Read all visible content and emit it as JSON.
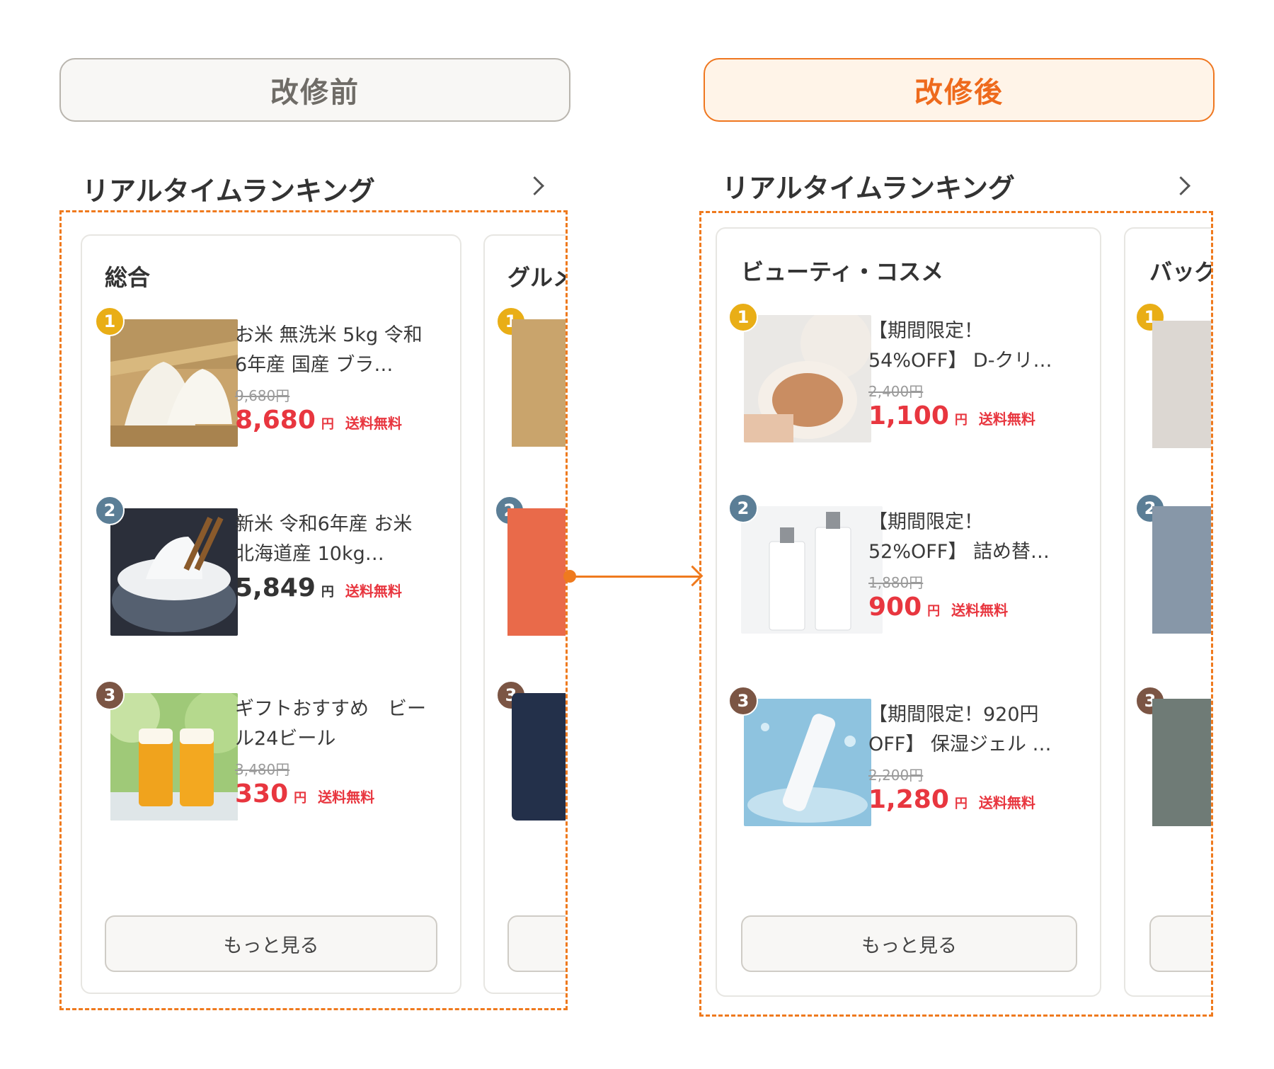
{
  "labels": {
    "before": "改修前",
    "after": "改修後"
  },
  "colors": {
    "accent": "#ef7a1e",
    "price_red": "#e8363f",
    "rank1": "#e9ae16",
    "rank2": "#5b7e96",
    "rank3": "#7b5544"
  },
  "before": {
    "section_title": "リアルタイムランキング",
    "main_card": {
      "title": "総合",
      "items": [
        {
          "rank": "1",
          "name": "お米 無洗米 5kg 令和6年産 国産 ブラ…",
          "old_price": "9,680円",
          "price": "8,680",
          "yen": "円",
          "shipping": "送料無料",
          "image": "rice-ball-image"
        },
        {
          "rank": "2",
          "name": "新米 令和6年産 お米 北海道産 10kg…",
          "old_price": "",
          "price": "5,849",
          "yen": "円",
          "shipping": "送料無料",
          "image": "rice-bowl-image"
        },
        {
          "rank": "3",
          "name": "ギフトおすすめ　ビール24ビール",
          "old_price": "3,480円",
          "price": "330",
          "yen": "円",
          "shipping": "送料無料",
          "image": "beer-image"
        }
      ],
      "more": "もっと見る"
    },
    "peek_card": {
      "title": "グルメ"
    }
  },
  "after": {
    "section_title": "リアルタイムランキング",
    "main_card": {
      "title": "ビューティ・コスメ",
      "items": [
        {
          "rank": "1",
          "name": "【期間限定！54%OFF】 D-クリ…",
          "old_price": "2,400円",
          "price": "1,100",
          "yen": "円",
          "shipping": "送料無料",
          "image": "cushion-compact-image"
        },
        {
          "rank": "2",
          "name": "【期間限定！52%OFF】 詰め替…",
          "old_price": "1,880円",
          "price": "900",
          "yen": "円",
          "shipping": "送料無料",
          "image": "skin-lotion-bottles-image"
        },
        {
          "rank": "3",
          "name": "【期間限定！920円OFF】 保湿ジェル …",
          "old_price": "2,200円",
          "price": "1,280",
          "yen": "円",
          "shipping": "送料無料",
          "image": "gel-tube-splash-image"
        }
      ],
      "more": "もっと見る"
    },
    "peek_card": {
      "title": "バッグ"
    }
  }
}
